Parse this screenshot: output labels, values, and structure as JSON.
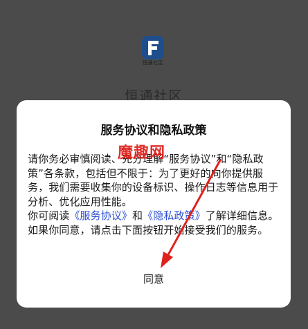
{
  "app": {
    "logo_caption": "恒通社区",
    "name": "恒通社区"
  },
  "dialog": {
    "title": "服务协议和隐私政策",
    "paragraph1": "请你务必审慎阅读、充分理解“服务协议”和“隐私政策”各条款，包括但不限于：为了更好的向你提供服务，我们需要收集你的设备标识、操作日志等信息用于分析、优化应用性能。",
    "p2_prefix": "你可阅读",
    "service_link": "《服务协议》",
    "p2_and": "和",
    "privacy_link": "《隐私政策》",
    "p2_suffix": "了解详细信息。如果你同意，请点击下面按钮开始接受我们的服务。",
    "agree_label": "同意"
  },
  "annotation": {
    "watermark": "魔趣网",
    "arrow_color": "#e0211c"
  },
  "colors": {
    "overlay": "#4b4b4b",
    "link": "#2b4fd6",
    "logo": "#1f4e8c"
  }
}
